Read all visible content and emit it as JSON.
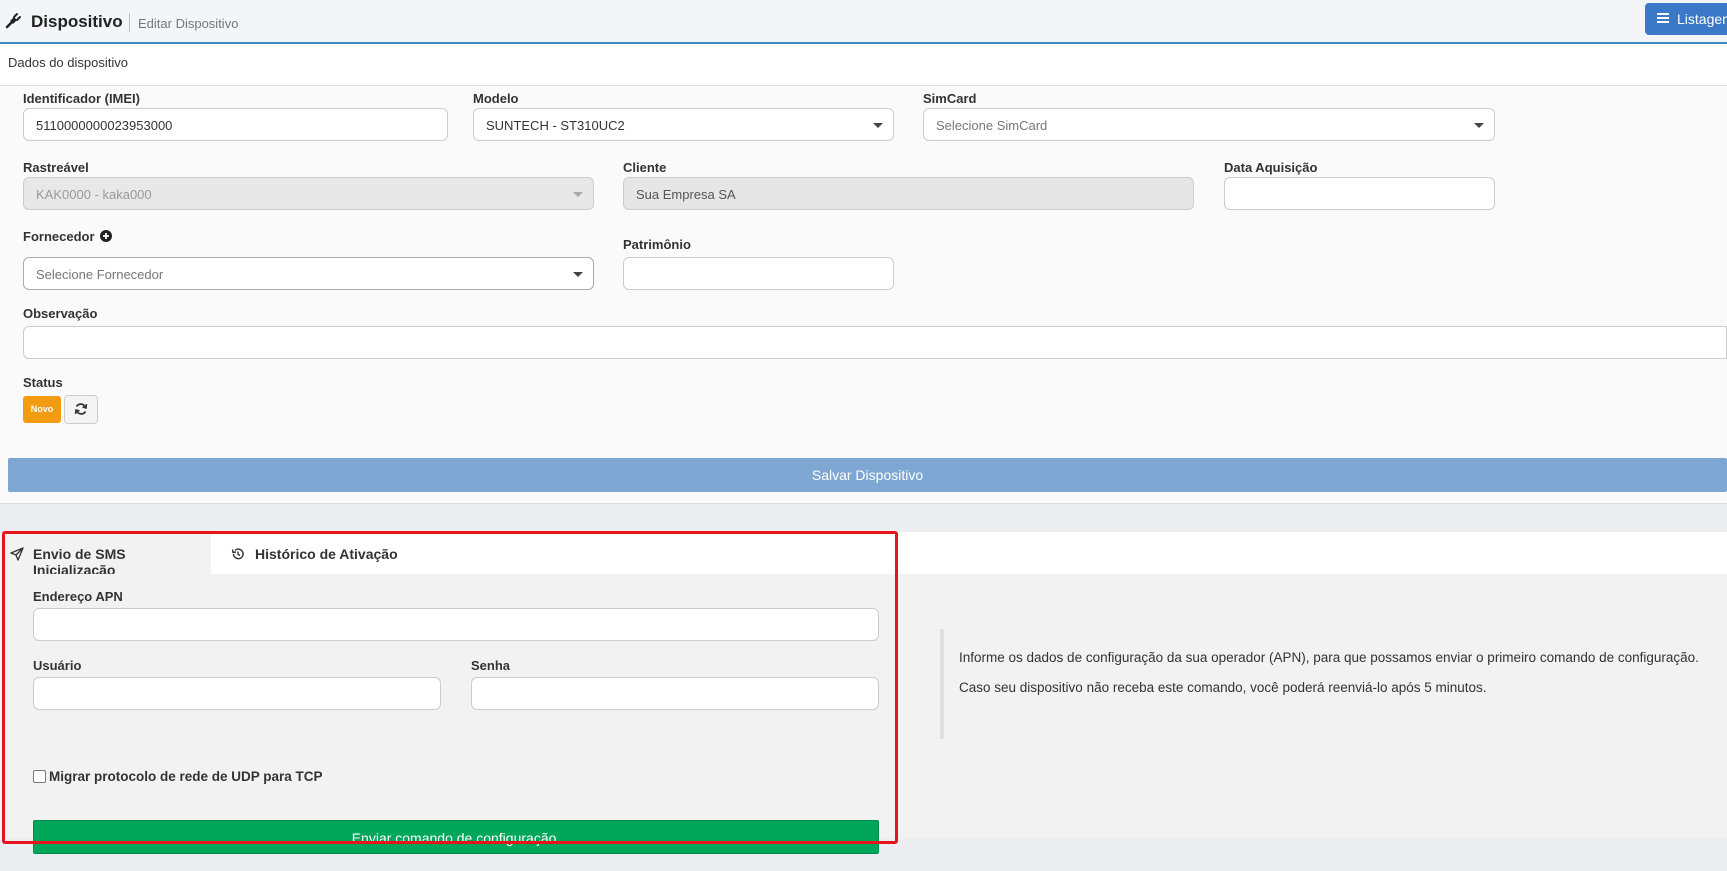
{
  "header": {
    "title": "Dispositivo",
    "subtitle": "Editar Dispositivo",
    "list_button_label": "Listagem"
  },
  "card": {
    "heading": "Dados do dispositivo"
  },
  "form": {
    "imei": {
      "label": "Identificador (IMEI)",
      "value": "5110000000023953000"
    },
    "modelo": {
      "label": "Modelo",
      "value": "SUNTECH - ST310UC2"
    },
    "simcard": {
      "label": "SimCard",
      "placeholder": "Selecione SimCard"
    },
    "rastreavel": {
      "label": "Rastreável",
      "value": "KAK0000 - kaka000"
    },
    "cliente": {
      "label": "Cliente",
      "value": "Sua Empresa SA"
    },
    "data_aquisicao": {
      "label": "Data Aquisição",
      "value": ""
    },
    "fornecedor": {
      "label": "Fornecedor",
      "placeholder": "Selecione Fornecedor"
    },
    "patrimonio": {
      "label": "Patrimônio",
      "value": ""
    },
    "observacao": {
      "label": "Observação",
      "value": ""
    },
    "status": {
      "label": "Status",
      "badge": "Novo",
      "badge_color": "#f39c12"
    },
    "save_label": "Salvar Dispositivo"
  },
  "tabs": {
    "sms": "Envio de SMS Inicialização",
    "history": "Histórico de Ativação"
  },
  "sms": {
    "apn_label": "Endereço APN",
    "user_label": "Usuário",
    "password_label": "Senha",
    "migrate_label": "Migrar protocolo de rede de UDP para TCP",
    "migrate_checked": false,
    "send_label": "Enviar comando de configuração.",
    "info_line1": "Informe os dados de configuração da sua operador (APN), para que possamos enviar o primeiro comando de configuração.",
    "info_line2": "Caso seu dispositivo não receba este comando, você poderá reenviá-lo após 5 minutos."
  },
  "colors": {
    "accent": "#3c8dbc",
    "save_button": "#7da7d2",
    "send_button": "#00a65a",
    "highlight_border": "#e8141c"
  }
}
